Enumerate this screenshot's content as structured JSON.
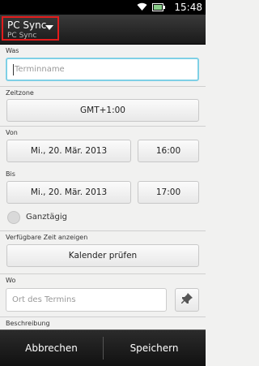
{
  "status": {
    "time": "15:48"
  },
  "header": {
    "calendar_title": "PC Sync",
    "calendar_account": "PC Sync"
  },
  "form": {
    "was_label": "Was",
    "title_placeholder": "Terminname",
    "timezone_label": "Zeitzone",
    "timezone_value": "GMT+1:00",
    "from_label": "Von",
    "from_date": "Mi., 20. Mär. 2013",
    "from_time": "16:00",
    "to_label": "Bis",
    "to_date": "Mi., 20. Mär. 2013",
    "to_time": "17:00",
    "allday_label": "Ganztägig",
    "availability_label": "Verfügbare Zeit anzeigen",
    "check_calendar": "Kalender prüfen",
    "where_label": "Wo",
    "location_placeholder": "Ort des Termins",
    "description_label": "Beschreibung"
  },
  "footer": {
    "cancel": "Abbrechen",
    "save": "Speichern"
  }
}
